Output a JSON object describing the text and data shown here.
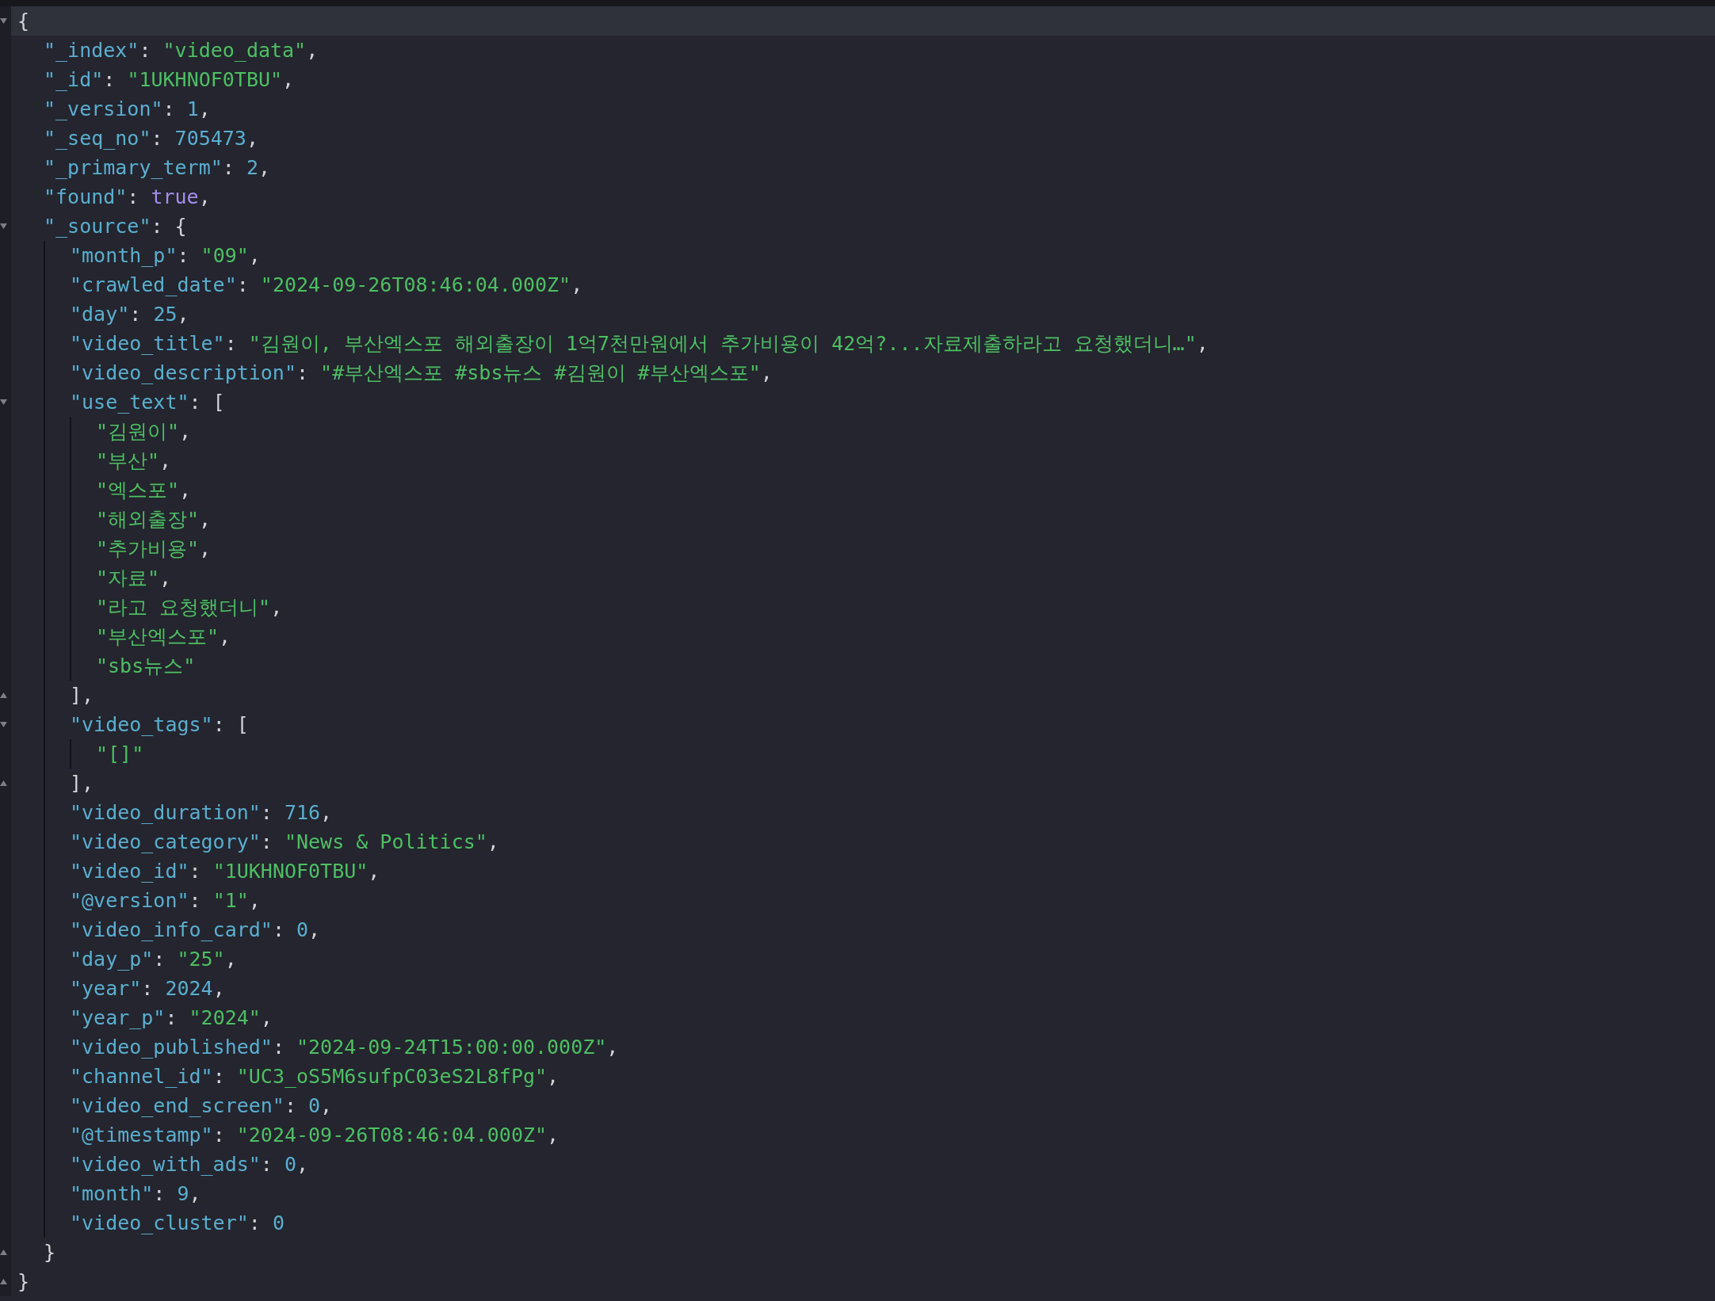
{
  "editor": {
    "root": {
      "current": true,
      "line": [
        {
          "kind": "punct",
          "text": "{"
        }
      ],
      "children": [
        {
          "current": false,
          "line": [
            {
              "kind": "key",
              "text": "\"_index\""
            },
            {
              "kind": "punct",
              "text": ": "
            },
            {
              "kind": "string",
              "text": "\"video_data\""
            },
            {
              "kind": "punct",
              "text": ","
            }
          ]
        },
        {
          "current": false,
          "line": [
            {
              "kind": "key",
              "text": "\"_id\""
            },
            {
              "kind": "punct",
              "text": ": "
            },
            {
              "kind": "string",
              "text": "\"1UKHNOF0TBU\""
            },
            {
              "kind": "punct",
              "text": ","
            }
          ]
        },
        {
          "current": false,
          "line": [
            {
              "kind": "key",
              "text": "\"_version\""
            },
            {
              "kind": "punct",
              "text": ": "
            },
            {
              "kind": "number",
              "text": "1"
            },
            {
              "kind": "punct",
              "text": ","
            }
          ]
        },
        {
          "current": false,
          "line": [
            {
              "kind": "key",
              "text": "\"_seq_no\""
            },
            {
              "kind": "punct",
              "text": ": "
            },
            {
              "kind": "number",
              "text": "705473"
            },
            {
              "kind": "punct",
              "text": ","
            }
          ]
        },
        {
          "current": false,
          "line": [
            {
              "kind": "key",
              "text": "\"_primary_term\""
            },
            {
              "kind": "punct",
              "text": ": "
            },
            {
              "kind": "number",
              "text": "2"
            },
            {
              "kind": "punct",
              "text": ","
            }
          ]
        },
        {
          "current": false,
          "line": [
            {
              "kind": "key",
              "text": "\"found\""
            },
            {
              "kind": "punct",
              "text": ": "
            },
            {
              "kind": "boolean",
              "text": "true"
            },
            {
              "kind": "punct",
              "text": ","
            }
          ]
        },
        {
          "current": false,
          "line": [
            {
              "kind": "key",
              "text": "\"_source\""
            },
            {
              "kind": "punct",
              "text": ": {"
            }
          ],
          "close": [
            {
              "kind": "punct",
              "text": "}"
            }
          ],
          "children": [
            {
              "current": false,
              "line": [
                {
                  "kind": "key",
                  "text": "\"month_p\""
                },
                {
                  "kind": "punct",
                  "text": ": "
                },
                {
                  "kind": "string",
                  "text": "\"09\""
                },
                {
                  "kind": "punct",
                  "text": ","
                }
              ]
            },
            {
              "current": false,
              "line": [
                {
                  "kind": "key",
                  "text": "\"crawled_date\""
                },
                {
                  "kind": "punct",
                  "text": ": "
                },
                {
                  "kind": "string",
                  "text": "\"2024-09-26T08:46:04.000Z\""
                },
                {
                  "kind": "punct",
                  "text": ","
                }
              ]
            },
            {
              "current": false,
              "line": [
                {
                  "kind": "key",
                  "text": "\"day\""
                },
                {
                  "kind": "punct",
                  "text": ": "
                },
                {
                  "kind": "number",
                  "text": "25"
                },
                {
                  "kind": "punct",
                  "text": ","
                }
              ]
            },
            {
              "current": false,
              "line": [
                {
                  "kind": "key",
                  "text": "\"video_title\""
                },
                {
                  "kind": "punct",
                  "text": ": "
                },
                {
                  "kind": "string",
                  "text": "\"김원이, 부산엑스포 해외출장이 1억7천만원에서 추가비용이 42억?...자료제출하라고 요청했더니…\""
                },
                {
                  "kind": "punct",
                  "text": ","
                }
              ]
            },
            {
              "current": false,
              "line": [
                {
                  "kind": "key",
                  "text": "\"video_description\""
                },
                {
                  "kind": "punct",
                  "text": ": "
                },
                {
                  "kind": "string",
                  "text": "\"#부산엑스포 #sbs뉴스 #김원이 #부산엑스포\""
                },
                {
                  "kind": "punct",
                  "text": ","
                }
              ]
            },
            {
              "current": false,
              "line": [
                {
                  "kind": "key",
                  "text": "\"use_text\""
                },
                {
                  "kind": "punct",
                  "text": ": ["
                }
              ],
              "close": [
                {
                  "kind": "punct",
                  "text": "],"
                }
              ],
              "children": [
                {
                  "current": false,
                  "line": [
                    {
                      "kind": "string",
                      "text": "\"김원이\""
                    },
                    {
                      "kind": "punct",
                      "text": ","
                    }
                  ]
                },
                {
                  "current": false,
                  "line": [
                    {
                      "kind": "string",
                      "text": "\"부산\""
                    },
                    {
                      "kind": "punct",
                      "text": ","
                    }
                  ]
                },
                {
                  "current": false,
                  "line": [
                    {
                      "kind": "string",
                      "text": "\"엑스포\""
                    },
                    {
                      "kind": "punct",
                      "text": ","
                    }
                  ]
                },
                {
                  "current": false,
                  "line": [
                    {
                      "kind": "string",
                      "text": "\"해외출장\""
                    },
                    {
                      "kind": "punct",
                      "text": ","
                    }
                  ]
                },
                {
                  "current": false,
                  "line": [
                    {
                      "kind": "string",
                      "text": "\"추가비용\""
                    },
                    {
                      "kind": "punct",
                      "text": ","
                    }
                  ]
                },
                {
                  "current": false,
                  "line": [
                    {
                      "kind": "string",
                      "text": "\"자료\""
                    },
                    {
                      "kind": "punct",
                      "text": ","
                    }
                  ]
                },
                {
                  "current": false,
                  "line": [
                    {
                      "kind": "string",
                      "text": "\"라고 요청했더니\""
                    },
                    {
                      "kind": "punct",
                      "text": ","
                    }
                  ]
                },
                {
                  "current": false,
                  "line": [
                    {
                      "kind": "string",
                      "text": "\"부산엑스포\""
                    },
                    {
                      "kind": "punct",
                      "text": ","
                    }
                  ]
                },
                {
                  "current": false,
                  "line": [
                    {
                      "kind": "string",
                      "text": "\"sbs뉴스\""
                    }
                  ]
                }
              ]
            },
            {
              "current": false,
              "line": [
                {
                  "kind": "key",
                  "text": "\"video_tags\""
                },
                {
                  "kind": "punct",
                  "text": ": ["
                }
              ],
              "close": [
                {
                  "kind": "punct",
                  "text": "],"
                }
              ],
              "children": [
                {
                  "current": false,
                  "line": [
                    {
                      "kind": "string",
                      "text": "\"[]\""
                    }
                  ]
                }
              ]
            },
            {
              "current": false,
              "line": [
                {
                  "kind": "key",
                  "text": "\"video_duration\""
                },
                {
                  "kind": "punct",
                  "text": ": "
                },
                {
                  "kind": "number",
                  "text": "716"
                },
                {
                  "kind": "punct",
                  "text": ","
                }
              ]
            },
            {
              "current": false,
              "line": [
                {
                  "kind": "key",
                  "text": "\"video_category\""
                },
                {
                  "kind": "punct",
                  "text": ": "
                },
                {
                  "kind": "string",
                  "text": "\"News & Politics\""
                },
                {
                  "kind": "punct",
                  "text": ","
                }
              ]
            },
            {
              "current": false,
              "line": [
                {
                  "kind": "key",
                  "text": "\"video_id\""
                },
                {
                  "kind": "punct",
                  "text": ": "
                },
                {
                  "kind": "string",
                  "text": "\"1UKHNOF0TBU\""
                },
                {
                  "kind": "punct",
                  "text": ","
                }
              ]
            },
            {
              "current": false,
              "line": [
                {
                  "kind": "key",
                  "text": "\"@version\""
                },
                {
                  "kind": "punct",
                  "text": ": "
                },
                {
                  "kind": "string",
                  "text": "\"1\""
                },
                {
                  "kind": "punct",
                  "text": ","
                }
              ]
            },
            {
              "current": false,
              "line": [
                {
                  "kind": "key",
                  "text": "\"video_info_card\""
                },
                {
                  "kind": "punct",
                  "text": ": "
                },
                {
                  "kind": "number",
                  "text": "0"
                },
                {
                  "kind": "punct",
                  "text": ","
                }
              ]
            },
            {
              "current": false,
              "line": [
                {
                  "kind": "key",
                  "text": "\"day_p\""
                },
                {
                  "kind": "punct",
                  "text": ": "
                },
                {
                  "kind": "string",
                  "text": "\"25\""
                },
                {
                  "kind": "punct",
                  "text": ","
                }
              ]
            },
            {
              "current": false,
              "line": [
                {
                  "kind": "key",
                  "text": "\"year\""
                },
                {
                  "kind": "punct",
                  "text": ": "
                },
                {
                  "kind": "number",
                  "text": "2024"
                },
                {
                  "kind": "punct",
                  "text": ","
                }
              ]
            },
            {
              "current": false,
              "line": [
                {
                  "kind": "key",
                  "text": "\"year_p\""
                },
                {
                  "kind": "punct",
                  "text": ": "
                },
                {
                  "kind": "string",
                  "text": "\"2024\""
                },
                {
                  "kind": "punct",
                  "text": ","
                }
              ]
            },
            {
              "current": false,
              "line": [
                {
                  "kind": "key",
                  "text": "\"video_published\""
                },
                {
                  "kind": "punct",
                  "text": ": "
                },
                {
                  "kind": "string",
                  "text": "\"2024-09-24T15:00:00.000Z\""
                },
                {
                  "kind": "punct",
                  "text": ","
                }
              ]
            },
            {
              "current": false,
              "line": [
                {
                  "kind": "key",
                  "text": "\"channel_id\""
                },
                {
                  "kind": "punct",
                  "text": ": "
                },
                {
                  "kind": "string",
                  "text": "\"UC3_oS5M6sufpC03eS2L8fPg\""
                },
                {
                  "kind": "punct",
                  "text": ","
                }
              ]
            },
            {
              "current": false,
              "line": [
                {
                  "kind": "key",
                  "text": "\"video_end_screen\""
                },
                {
                  "kind": "punct",
                  "text": ": "
                },
                {
                  "kind": "number",
                  "text": "0"
                },
                {
                  "kind": "punct",
                  "text": ","
                }
              ]
            },
            {
              "current": false,
              "line": [
                {
                  "kind": "key",
                  "text": "\"@timestamp\""
                },
                {
                  "kind": "punct",
                  "text": ": "
                },
                {
                  "kind": "string",
                  "text": "\"2024-09-26T08:46:04.000Z\""
                },
                {
                  "kind": "punct",
                  "text": ","
                }
              ]
            },
            {
              "current": false,
              "line": [
                {
                  "kind": "key",
                  "text": "\"video_with_ads\""
                },
                {
                  "kind": "punct",
                  "text": ": "
                },
                {
                  "kind": "number",
                  "text": "0"
                },
                {
                  "kind": "punct",
                  "text": ","
                }
              ]
            },
            {
              "current": false,
              "line": [
                {
                  "kind": "key",
                  "text": "\"month\""
                },
                {
                  "kind": "punct",
                  "text": ": "
                },
                {
                  "kind": "number",
                  "text": "9"
                },
                {
                  "kind": "punct",
                  "text": ","
                }
              ]
            },
            {
              "current": false,
              "line": [
                {
                  "kind": "key",
                  "text": "\"video_cluster\""
                },
                {
                  "kind": "punct",
                  "text": ": "
                },
                {
                  "kind": "number",
                  "text": "0"
                }
              ]
            }
          ]
        }
      ],
      "close": [
        {
          "kind": "punct",
          "text": "}"
        }
      ]
    }
  }
}
